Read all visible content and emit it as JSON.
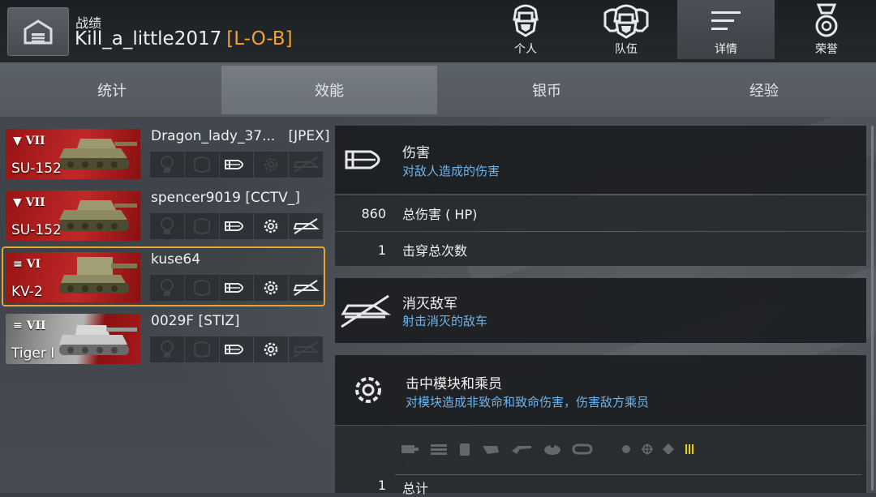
{
  "header": {
    "section_title": "战绩",
    "player_name": "Kill_a_little2017",
    "clan_tag": "[L-O-B]"
  },
  "top_tabs": [
    {
      "label": "个人",
      "icon": "soldier-helmet-icon"
    },
    {
      "label": "队伍",
      "icon": "team-helmets-icon"
    },
    {
      "label": "详情",
      "icon": "details-lines-icon",
      "active": true
    },
    {
      "label": "荣誉",
      "icon": "medal-icon"
    }
  ],
  "sub_tabs": [
    {
      "label": "统计"
    },
    {
      "label": "效能",
      "active": true
    },
    {
      "label": "银币"
    },
    {
      "label": "经验"
    }
  ],
  "players": [
    {
      "tank": "SU-152",
      "tier": "VII",
      "nation": "ussr",
      "name": "Dragon_lady_37...",
      "clan": "[JPEX]",
      "active_icons": [
        false,
        false,
        true,
        false,
        false
      ]
    },
    {
      "tank": "SU-152",
      "tier": "VII",
      "nation": "ussr",
      "name": "spencer9019 [CCTV_]",
      "clan": "",
      "active_icons": [
        false,
        false,
        true,
        true,
        true
      ]
    },
    {
      "tank": "KV-2",
      "tier": "VI",
      "nation": "ussr",
      "name": "kuse64",
      "clan": "",
      "selected": true,
      "active_icons": [
        false,
        false,
        true,
        true,
        true
      ]
    },
    {
      "tank": "Tiger I",
      "tier": "VII",
      "nation": "germany",
      "name": "0029F [STIZ]",
      "clan": "",
      "active_icons": [
        false,
        false,
        true,
        true,
        false
      ]
    }
  ],
  "player_icons": [
    "lightbulb-icon",
    "track-icon",
    "shell-icon",
    "gear-icon",
    "destroyed-tank-icon"
  ],
  "details": {
    "damage": {
      "title": "伤害",
      "subtitle": "对敌人造成的伤害",
      "rows": [
        {
          "value": "860",
          "label": "总伤害 ( HP)"
        },
        {
          "value": "1",
          "label": "击穿总次数"
        }
      ]
    },
    "destroyed": {
      "title": "消灭敌军",
      "subtitle": "射击消灭的敌车"
    },
    "modules": {
      "title": "击中模块和乘员",
      "subtitle": "对模块造成非致命和致命伤害，伤害敌方乘员",
      "module_icons": [
        "engine-icon",
        "ammo-rack-icon",
        "fuel-tank-icon",
        "radio-icon",
        "gun-icon",
        "turret-icon",
        "track-icon",
        "optics-icon",
        "commander-icon",
        "gunner-icon",
        "driver-icon",
        "loader-icon"
      ],
      "partial_row": {
        "value": "1",
        "label": "总计"
      }
    }
  },
  "colors": {
    "accent_orange": "#f0a030",
    "subtitle_blue": "#6fb3e8"
  }
}
